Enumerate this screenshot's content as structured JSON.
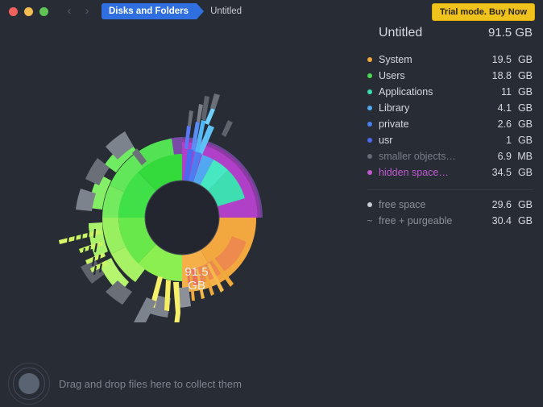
{
  "window": {
    "traffic_lights": [
      "close",
      "minimize",
      "zoom"
    ],
    "nav_back": "‹",
    "nav_forward": "›",
    "breadcrumb_active": "Disks and Folders",
    "breadcrumb_current": "Untitled",
    "trial_button": "Trial mode. Buy Now"
  },
  "panel": {
    "title": "Untitled",
    "total": "91.5 GB",
    "items": [
      {
        "label": "System",
        "num": "19.5",
        "unit": "GB",
        "color": "#f0a93c"
      },
      {
        "label": "Users",
        "num": "18.8",
        "unit": "GB",
        "color": "#4bd852"
      },
      {
        "label": "Applications",
        "num": "11",
        "unit": "GB",
        "color": "#3ddfb0"
      },
      {
        "label": "Library",
        "num": "4.1",
        "unit": "GB",
        "color": "#52a8f0"
      },
      {
        "label": "private",
        "num": "2.6",
        "unit": "GB",
        "color": "#4b7ef0"
      },
      {
        "label": "usr",
        "num": "1",
        "unit": "GB",
        "color": "#4b68f0"
      },
      {
        "label": "smaller objects…",
        "num": "6.9",
        "unit": "MB",
        "color": "#646a76",
        "dim": true
      },
      {
        "label": "hidden space…",
        "num": "34.5",
        "unit": "GB",
        "color": "#c15ad0",
        "hidden": true
      }
    ],
    "free": [
      {
        "label": "free space",
        "num": "29.6",
        "unit": "GB",
        "marker": "dot"
      },
      {
        "label": "free + purgeable",
        "num": "30.4",
        "unit": "GB",
        "marker": "tilde"
      }
    ]
  },
  "chart_data": {
    "type": "pie",
    "title": "Disk usage sunburst",
    "center_value": "91.5",
    "center_unit": "GB",
    "total_gb": 91.5,
    "slices": [
      {
        "name": "System",
        "value": 19.5,
        "color": "#f0a93c"
      },
      {
        "name": "Users",
        "value": 18.8,
        "color": "#4bd852"
      },
      {
        "name": "Applications",
        "value": 11.0,
        "color": "#3ddfb0"
      },
      {
        "name": "Library",
        "value": 4.1,
        "color": "#52a8f0"
      },
      {
        "name": "private",
        "value": 2.6,
        "color": "#4b7ef0"
      },
      {
        "name": "usr",
        "value": 1.0,
        "color": "#4b68f0"
      },
      {
        "name": "smaller objects",
        "value": 0.0069,
        "color": "#646a76"
      },
      {
        "name": "hidden space",
        "value": 34.5,
        "color": "#a044c0"
      }
    ]
  },
  "dropzone": {
    "text": "Drag and drop files here to collect them"
  }
}
